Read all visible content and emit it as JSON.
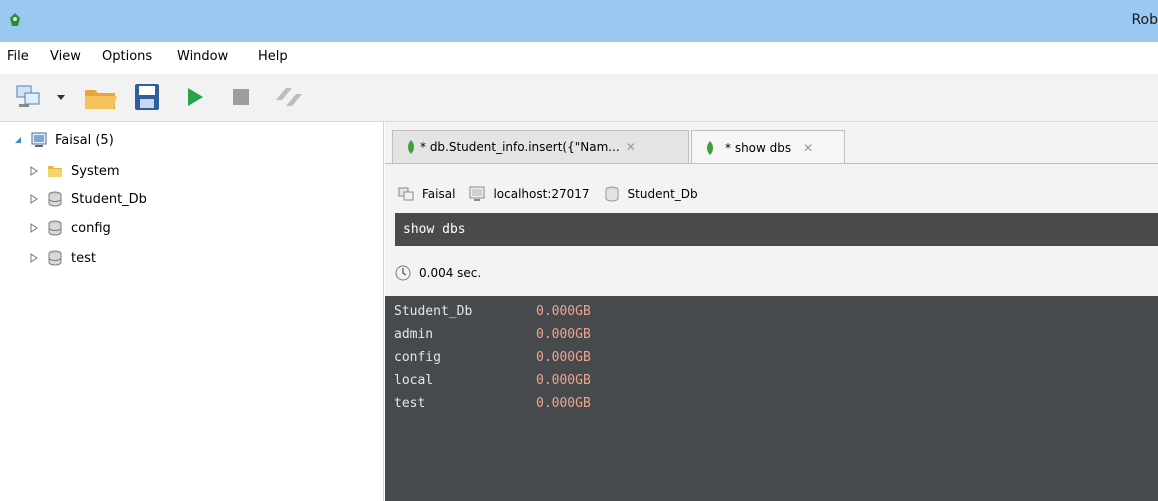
{
  "window": {
    "title": "Rob"
  },
  "menu": {
    "items": [
      "File",
      "View",
      "Options",
      "Window",
      "Help"
    ]
  },
  "toolbar": {
    "buttons": [
      {
        "name": "connect-icon"
      },
      {
        "name": "dropdown-arrow-icon"
      },
      {
        "name": "open-folder-icon"
      },
      {
        "name": "save-icon"
      },
      {
        "name": "run-icon"
      },
      {
        "name": "stop-icon"
      },
      {
        "name": "format-icon"
      }
    ]
  },
  "tree": {
    "root": {
      "label": "Faisal (5)",
      "icon": "server-icon"
    },
    "children": [
      {
        "label": "System",
        "icon": "folder-icon"
      },
      {
        "label": "Student_Db",
        "icon": "database-icon"
      },
      {
        "label": "config",
        "icon": "database-icon"
      },
      {
        "label": "test",
        "icon": "database-icon"
      }
    ]
  },
  "tabs": [
    {
      "label": "* db.Student_info.insert({\"Nam...",
      "close": "✕",
      "active": false
    },
    {
      "label": "* show dbs",
      "close": "✕",
      "active": true
    }
  ],
  "connection": {
    "server": "Faisal",
    "host": "localhost:27017",
    "database": "Student_Db"
  },
  "query": {
    "text": "show dbs"
  },
  "status": {
    "time": "0.004 sec."
  },
  "output": {
    "rows": [
      {
        "name": "Student_Db",
        "size": "0.000GB"
      },
      {
        "name": "admin",
        "size": "0.000GB"
      },
      {
        "name": "config",
        "size": "0.000GB"
      },
      {
        "name": "local",
        "size": "0.000GB"
      },
      {
        "name": "test",
        "size": "0.000GB"
      }
    ]
  },
  "colors": {
    "titlebar": "#99c9f0",
    "output_bg": "#474a4c",
    "output_value": "#f0a38d",
    "mongo_leaf": "#3fa037"
  }
}
